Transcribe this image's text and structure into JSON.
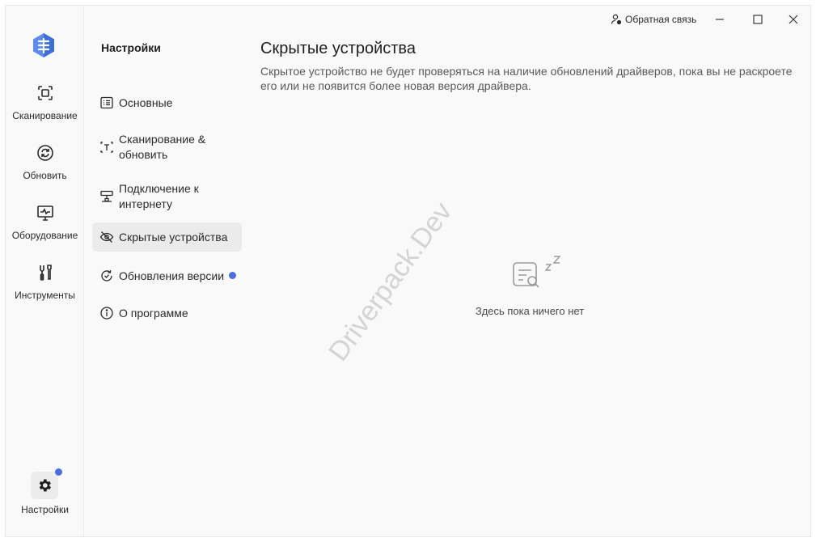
{
  "rail": {
    "items": [
      {
        "label": "Сканирование",
        "icon": "scan-icon"
      },
      {
        "label": "Обновить",
        "icon": "refresh-icon"
      },
      {
        "label": "Оборудование",
        "icon": "monitor-pulse-icon"
      },
      {
        "label": "Инструменты",
        "icon": "tools-icon"
      }
    ],
    "settings_label": "Настройки"
  },
  "nav": {
    "title": "Настройки",
    "items": [
      {
        "label": "Основные",
        "icon": "list-settings-icon"
      },
      {
        "label": "Сканирование & обновить",
        "icon": "scan-text-icon"
      },
      {
        "label": "Подключение к интернету",
        "icon": "network-icon"
      },
      {
        "label": "Скрытые устройства",
        "icon": "eye-off-icon"
      },
      {
        "label": "Обновления версии",
        "icon": "version-refresh-icon"
      },
      {
        "label": "О программе",
        "icon": "info-icon"
      }
    ]
  },
  "main": {
    "title": "Скрытые устройства",
    "description": "Скрытое устройство не будет проверяться на наличие обновлений драйверов, пока вы не раскроете его или не появится более новая версия драйвера.",
    "empty_text": "Здесь пока ничего нет"
  },
  "titlebar": {
    "feedback_label": "Обратная связь"
  },
  "watermark": "Driverpack.Dev",
  "colors": {
    "accent": "#4a6ee0",
    "active_bg": "#ebebeb",
    "background": "#f9f9f9"
  }
}
